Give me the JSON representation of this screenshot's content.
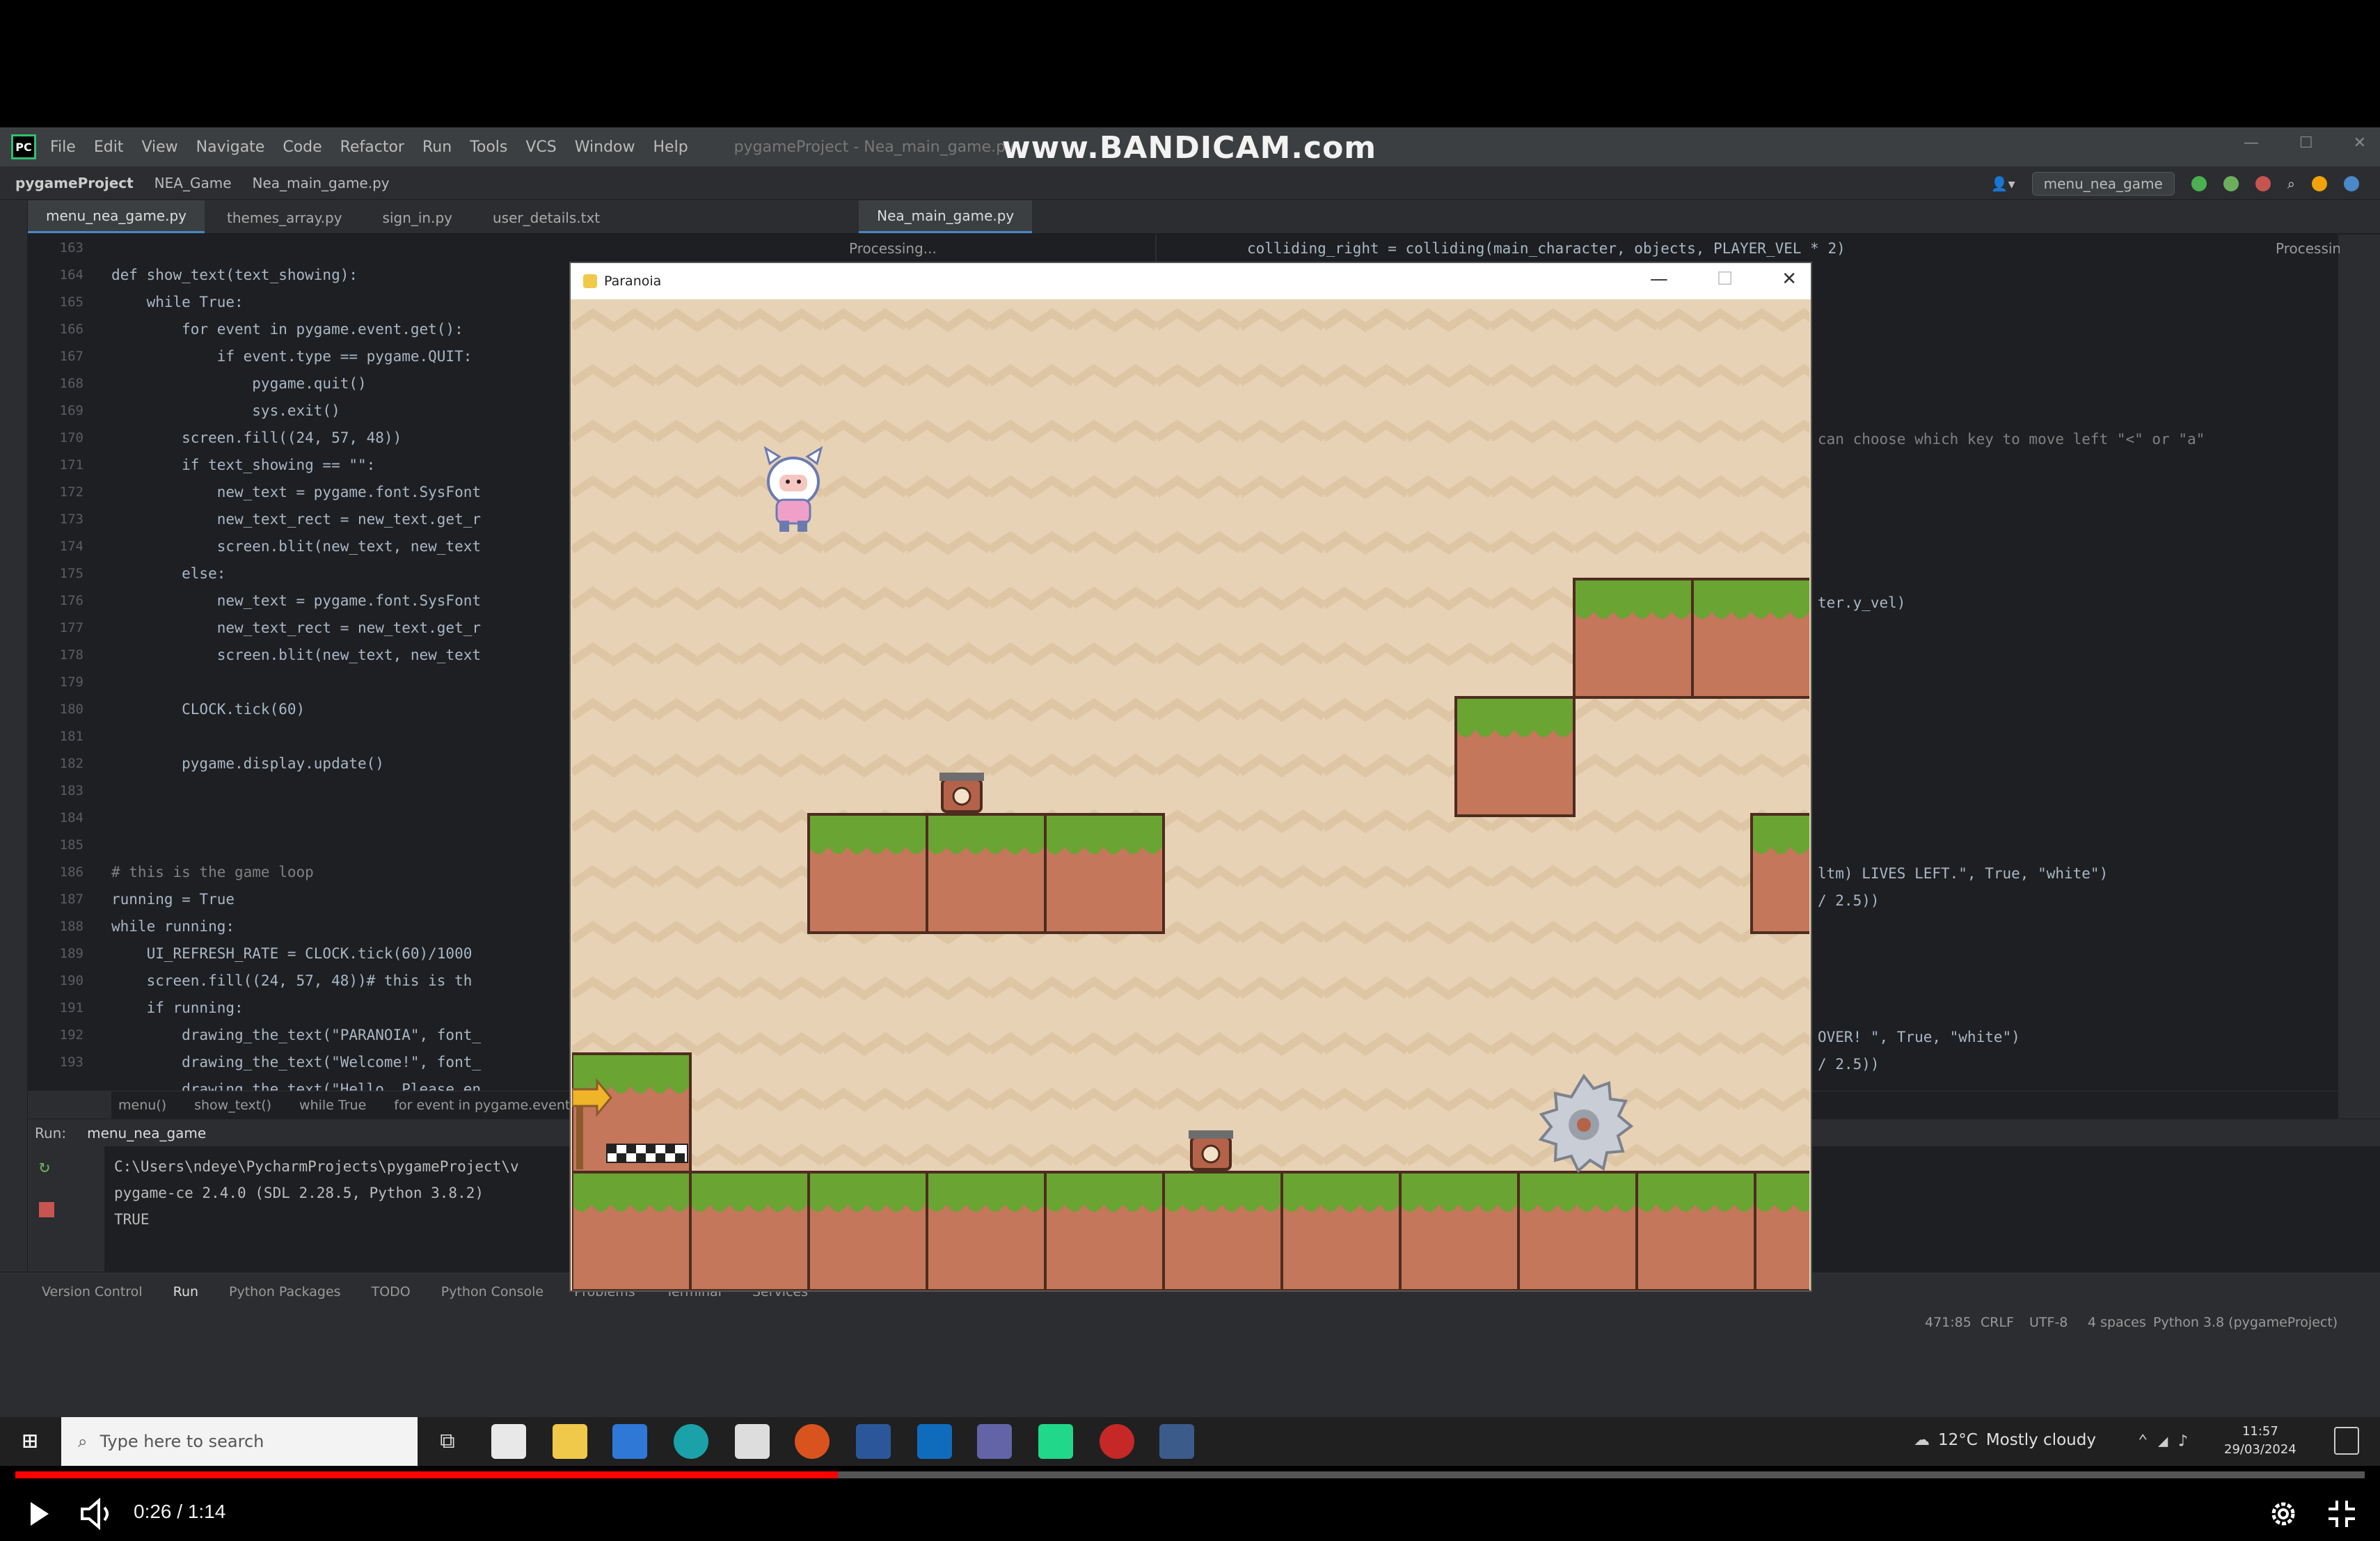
{
  "ide": {
    "menu_items": [
      "File",
      "Edit",
      "View",
      "Navigate",
      "Code",
      "Refactor",
      "Run",
      "Tools",
      "VCS",
      "Window",
      "Help"
    ],
    "project_title": "pygameProject - Nea_main_game.py",
    "watermark": "www.BANDICAM.com",
    "breadcrumb_project": "pygameProject",
    "breadcrumb_folder": "NEA_Game",
    "breadcrumb_file": "Nea_main_game.py",
    "run_config": "menu_nea_game",
    "tabs": [
      "menu_nea_game.py",
      "themes_array.py",
      "sign_in.py",
      "user_details.txt"
    ],
    "right_tab": "Nea_main_game.py",
    "processing_left": "Processing...",
    "processing_right": "Processing...",
    "line_numbers": [
      "163",
      "164",
      "165",
      "166",
      "167",
      "168",
      "169",
      "170",
      "171",
      "172",
      "173",
      "174",
      "175",
      "176",
      "177",
      "178",
      "179",
      "180",
      "181",
      "182",
      "183",
      "184",
      "185",
      "186",
      "187",
      "188",
      "189",
      "190",
      "191",
      "192",
      "193"
    ],
    "code_lines": [
      "",
      "def show_text(text_showing):",
      "    while True:",
      "        for event in pygame.event.get():",
      "            if event.type == pygame.QUIT:",
      "                pygame.quit()",
      "                sys.exit()",
      "        screen.fill((24, 57, 48))",
      "        if text_showing == \"\":",
      "            new_text = pygame.font.SysFont",
      "            new_text_rect = new_text.get_r",
      "            screen.blit(new_text, new_text",
      "        else:",
      "            new_text = pygame.font.SysFont",
      "            new_text_rect = new_text.get_r",
      "            screen.blit(new_text, new_text",
      "",
      "        CLOCK.tick(60)",
      "",
      "        pygame.display.update()",
      "",
      "",
      "",
      "# this is the game loop",
      "running = True",
      "while running:",
      "    UI_REFRESH_RATE = CLOCK.tick(60)/1000",
      "    screen.fill((24, 57, 48))# this is th",
      "    if running:",
      "        drawing_the_text(\"PARANOIA\", font_",
      "        drawing_the_text(\"Welcome!\", font_",
      "        drawing_the_text(\"Hello  Please en"
    ],
    "right_code_top": "colliding_right = colliding(main_character, objects, PLAYER_VEL * 2)",
    "right_code_a": "can choose which key to move left \"<\" or \"a\"",
    "right_code_b": "ter.y_vel)",
    "right_code_c": "ltm) LIVES LEFT.\", True, \"white\")",
    "right_code_d": "/ 2.5))",
    "right_code_e": "OVER! \", True, \"white\")",
    "right_code_f": "/ 2.5))",
    "crumbs": [
      "menu()",
      "show_text()",
      "while True",
      "for event in pygame.event..."
    ],
    "run_label": "Run:",
    "run_tab": "menu_nea_game",
    "console_lines": [
      "C:\\Users\\ndeye\\PycharmProjects\\pygameProject\\v",
      "pygame-ce 2.4.0 (SDL 2.28.5, Python 3.8.2)",
      "TRUE"
    ],
    "bottom_tools": [
      "Version Control",
      "Run",
      "Python Packages",
      "TODO",
      "Python Console",
      "Problems",
      "Terminal",
      "Services"
    ],
    "status": {
      "position": "471:85",
      "line_sep": "CRLF",
      "encoding": "UTF-8",
      "indent": "4 spaces",
      "interpreter": "Python 3.8 (pygameProject)"
    }
  },
  "game": {
    "window_title": "Paranoia",
    "minimize": "—",
    "maximize": "☐",
    "close": "✕"
  },
  "taskbar": {
    "search_placeholder": "Type here to search",
    "weather_temp": "12°C",
    "weather_text": "Mostly cloudy",
    "time": "11:57",
    "date": "29/03/2024"
  },
  "video": {
    "time_display": "0:26 / 1:14",
    "progress": 0.35,
    "colors": {
      "progress_played": "#ff0000",
      "progress_track": "#555555"
    }
  }
}
